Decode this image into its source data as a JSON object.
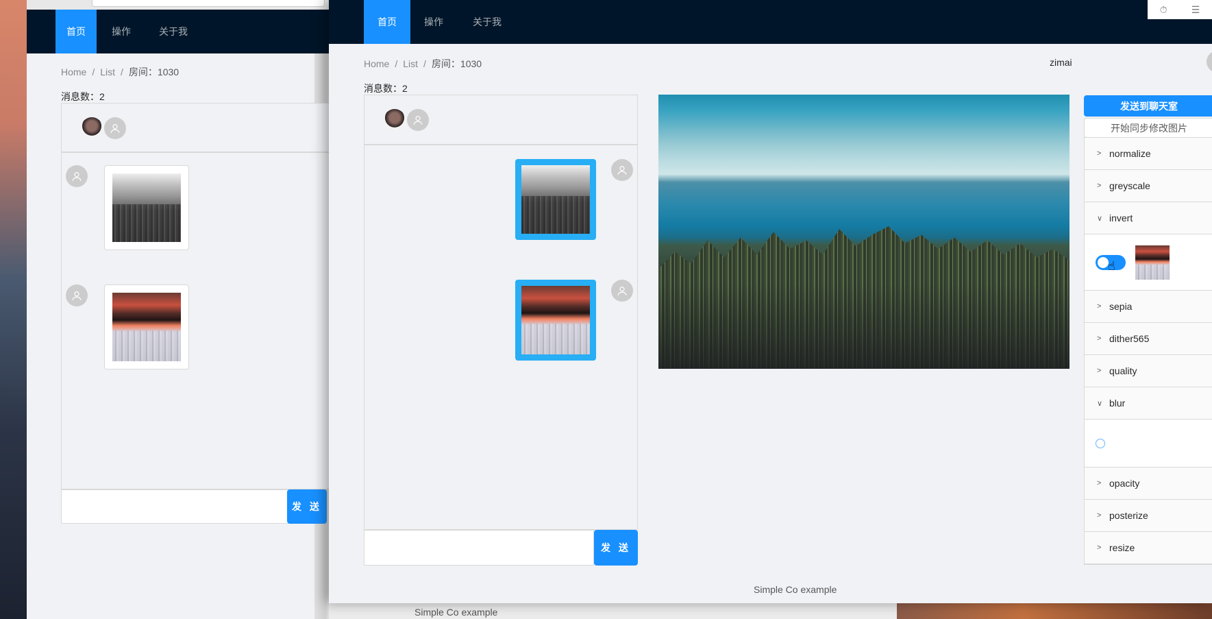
{
  "nav": {
    "items": [
      "首页",
      "操作",
      "关于我"
    ]
  },
  "breadcrumb": {
    "home": "Home",
    "list": "List",
    "room": "房间：1030",
    "sep": "/"
  },
  "message_count": "消息数：2",
  "send_label": "发 送",
  "right_panel": {
    "username": "zimai",
    "send_to_room": "发送到聊天室",
    "sync_edit": "开始同步修改图片",
    "filters": [
      {
        "label": "normalize",
        "expanded": false
      },
      {
        "label": "greyscale",
        "expanded": false
      },
      {
        "label": "invert",
        "expanded": true,
        "toggle_on": true
      },
      {
        "label": "sepia",
        "expanded": false
      },
      {
        "label": "dither565",
        "expanded": false
      },
      {
        "label": "quality",
        "expanded": false
      },
      {
        "label": "blur",
        "expanded": true
      },
      {
        "label": "opacity",
        "expanded": false
      },
      {
        "label": "posterize",
        "expanded": false
      },
      {
        "label": "resize",
        "expanded": false
      }
    ],
    "arrow_collapsed": ">",
    "arrow_expanded": "∨"
  },
  "footer": "Simple Co example",
  "bg_footer": "Simple Co example",
  "colors": {
    "nav_bg": "#001529",
    "primary": "#1890ff",
    "bubble_blue": "#27aef5"
  },
  "icons": [
    "person-icon",
    "timer-icon",
    "layers-icon",
    "cursor-hand-icon"
  ]
}
